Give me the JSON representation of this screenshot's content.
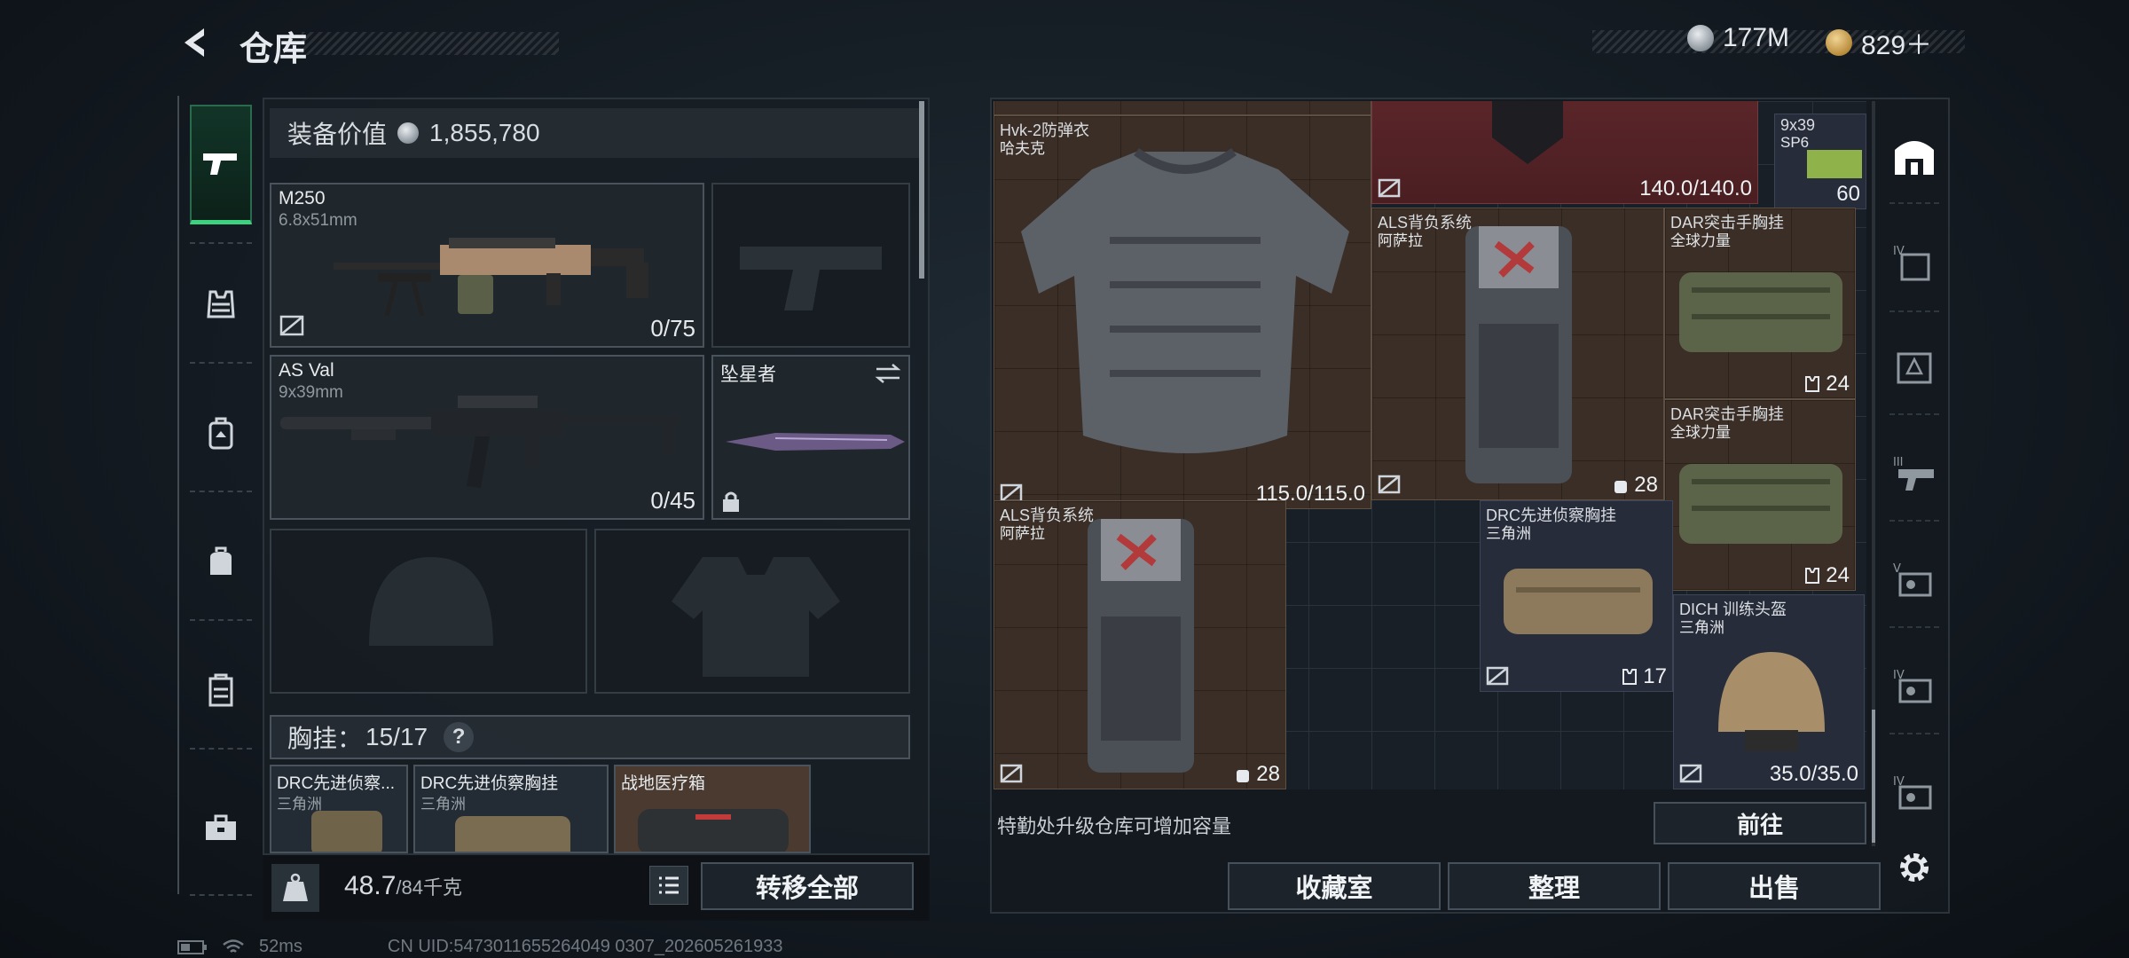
{
  "header": {
    "title": "仓库",
    "currency": [
      {
        "icon": "silver-coin-icon",
        "value": "177M"
      },
      {
        "icon": "gold-coin-icon",
        "value": "829＋"
      }
    ]
  },
  "sidebar": {
    "items": [
      {
        "name": "weapons",
        "icon": "pistol-icon",
        "active": true
      },
      {
        "name": "armor",
        "icon": "armor-vest-icon"
      },
      {
        "name": "backpack",
        "icon": "backpack-icon"
      },
      {
        "name": "bag",
        "icon": "bag-icon"
      },
      {
        "name": "container",
        "icon": "container-icon"
      },
      {
        "name": "toolbox",
        "icon": "toolbox-icon"
      }
    ]
  },
  "loadout": {
    "value_label": "装备价值",
    "value": "1,855,780",
    "primary": {
      "name": "M250",
      "caliber": "6.8x51mm",
      "ammo": "0/75"
    },
    "secondary": {
      "name": "AS Val",
      "caliber": "9x39mm",
      "ammo": "0/45"
    },
    "melee": {
      "name": "坠星者"
    },
    "rig_label": "胸挂：",
    "rig_capacity": "15/17",
    "rig_help": "?",
    "rig_items": [
      {
        "name": "DRC先进侦察...",
        "sub": "三角洲"
      },
      {
        "name": "DRC先进侦察胸挂",
        "sub": "三角洲"
      },
      {
        "name": "战地医疗箱",
        "sub": ""
      }
    ],
    "weight_current": "48.7",
    "weight_max": "/84千克",
    "transfer_all": "转移全部"
  },
  "stash": {
    "items": [
      {
        "name": "Hvk-2防弹衣",
        "sub": "哈夫克",
        "value": "115.0/115.0"
      },
      {
        "name": "",
        "sub": "",
        "value": "140.0/140.0"
      },
      {
        "name": "9x39",
        "sub": "SP6",
        "value": "60"
      },
      {
        "name": "ALS背负系统",
        "sub": "阿萨拉",
        "value": "28"
      },
      {
        "name": "DAR突击手胸挂",
        "sub": "全球力量",
        "value": "24"
      },
      {
        "name": "DAR突击手胸挂",
        "sub": "全球力量",
        "value": "24"
      },
      {
        "name": "ALS背负系统",
        "sub": "阿萨拉",
        "value": "28"
      },
      {
        "name": "DRC先进侦察胸挂",
        "sub": "三角洲",
        "value": "17"
      },
      {
        "name": "DICH 训练头盔",
        "sub": "三角洲",
        "value": "35.0/35.0"
      }
    ],
    "tip": "特勤处升级仓库可增加容量",
    "goto": "前往",
    "buttons": {
      "collection": "收藏室",
      "organize": "整理",
      "sell": "出售"
    }
  },
  "rail": {
    "tiers": [
      "IV",
      "",
      "III",
      "V",
      "IV",
      "IV"
    ]
  },
  "status": {
    "ping": "52ms",
    "uid": "CN UID:5473011655264049 0307_202605261933"
  }
}
